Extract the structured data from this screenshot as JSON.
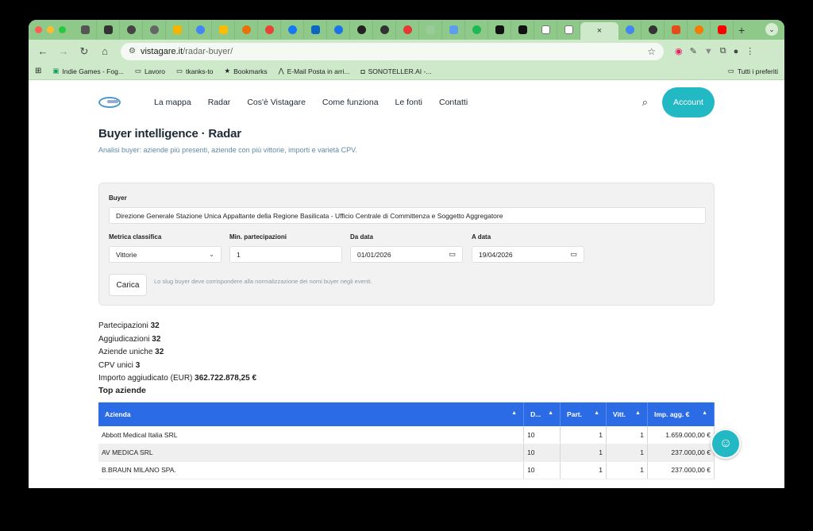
{
  "browser": {
    "url_host": "vistagare.it",
    "url_path": "/radar-buyer/",
    "active_tab_close": "×",
    "new_tab": "+",
    "tab_search": "⌄",
    "bookmarks": [
      {
        "label": "Indie Games - Fog...",
        "icon": "sheets-icon"
      },
      {
        "label": "Lavoro",
        "icon": "folder-icon"
      },
      {
        "label": "tkanks-to",
        "icon": "folder-icon"
      },
      {
        "label": "Bookmarks",
        "icon": "star-icon"
      },
      {
        "label": "E-Mail Posta in arri...",
        "icon": "mail-icon"
      },
      {
        "label": "SONOTELLER.AI -...",
        "icon": "site-icon"
      }
    ],
    "bookmarks_right": "Tutti i preferiti"
  },
  "site": {
    "nav": [
      "La mappa",
      "Radar",
      "Cos'è Vistagare",
      "Come funziona",
      "Le fonti",
      "Contatti"
    ],
    "account_label": "Account"
  },
  "page": {
    "title": "Buyer intelligence · Radar",
    "subtitle": "Analisi buyer: aziende più presenti, aziende con più vittorie, importi e varietà CPV."
  },
  "filters": {
    "buyer_label": "Buyer",
    "buyer_value": "Direzione Generale Stazione Unica Appaltante della Regione Basilicata - Ufficio Centrale di Committenza e Soggetto Aggregatore",
    "metric_label": "Metrica classifica",
    "metric_value": "Vittorie",
    "min_label": "Min. partecipazioni",
    "min_value": "1",
    "from_label": "Da data",
    "from_value": "01/01/2026",
    "to_label": "A data",
    "to_value": "19/04/2026",
    "load_button": "Carica",
    "hint": "Lo slug buyer deve corrispondere alla normalizzazione dei nomi buyer negli eventi."
  },
  "stats": [
    {
      "label": "Partecipazioni",
      "value": "32"
    },
    {
      "label": "Aggiudicazioni",
      "value": "32"
    },
    {
      "label": "Aziende uniche",
      "value": "32"
    },
    {
      "label": "CPV unici",
      "value": "3"
    },
    {
      "label": "Importo aggiudicato (EUR)",
      "value": "362.722.878,25 €"
    }
  ],
  "top_companies": {
    "title": "Top aziende",
    "columns": [
      "Azienda",
      "D...",
      "Part.",
      "Vitt.",
      "Imp. agg. €"
    ],
    "rows": [
      [
        "Abbott Medical Italia SRL",
        "10",
        "1",
        "1",
        "1.659.000,00 €"
      ],
      [
        "AV MEDICA SRL",
        "10",
        "1",
        "1",
        "237.000,00 €"
      ],
      [
        "B.BRAUN MILANO SPA.",
        "10",
        "1",
        "1",
        "237.000,00 €"
      ]
    ]
  },
  "colors": {
    "tabbar": "#8fc98a",
    "accent": "#22b8c4",
    "table_header": "#2c6be6"
  }
}
